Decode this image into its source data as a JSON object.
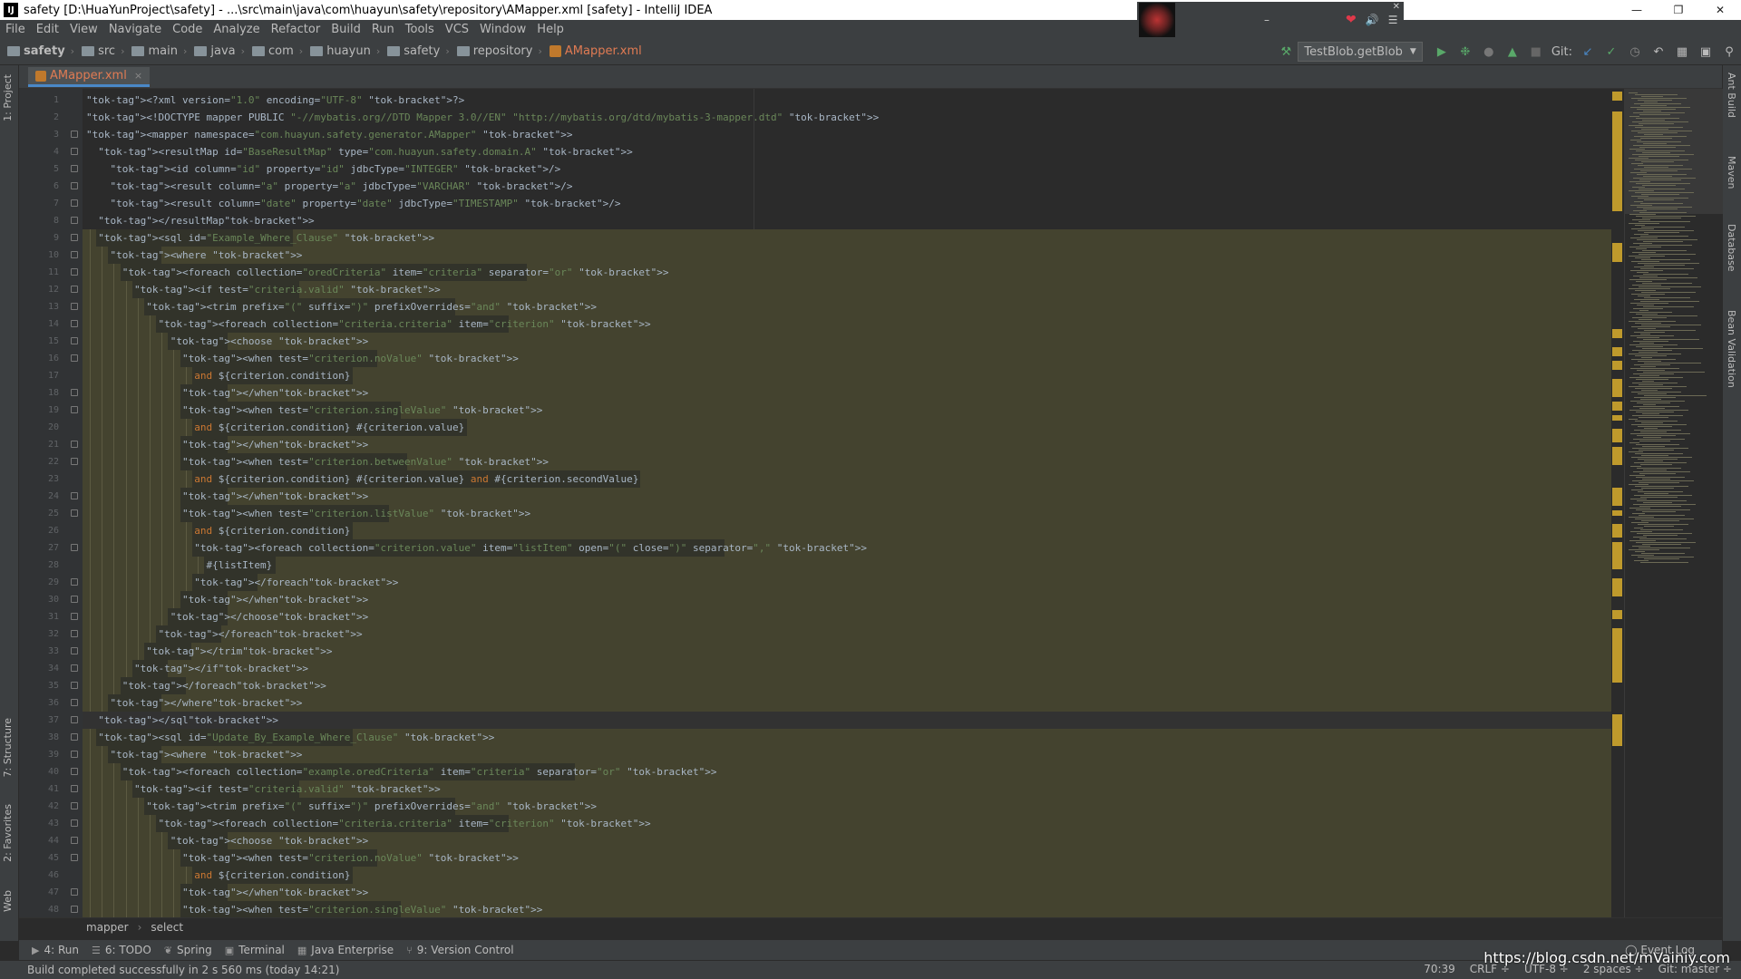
{
  "window": {
    "title": "safety [D:\\HuaYunProject\\safety] - ...\\src\\main\\java\\com\\huayun\\safety\\repository\\AMapper.xml [safety] - IntelliJ IDEA",
    "app_icon": "IJ"
  },
  "media_widget": {
    "min": "–",
    "close": "✕"
  },
  "menu": [
    "File",
    "Edit",
    "View",
    "Navigate",
    "Code",
    "Analyze",
    "Refactor",
    "Build",
    "Run",
    "Tools",
    "VCS",
    "Window",
    "Help"
  ],
  "breadcrumb": [
    "safety",
    "src",
    "main",
    "java",
    "com",
    "huayun",
    "safety",
    "repository",
    "AMapper.xml"
  ],
  "toolbar": {
    "run_config": "TestBlob.getBlob",
    "git_label": "Git:"
  },
  "left_tabs": [
    "1: Project",
    "7: Structure",
    "2: Favorites",
    "Web"
  ],
  "right_tabs": [
    "Ant Build",
    "Maven",
    "Database",
    "Bean Validation"
  ],
  "editor_tab": {
    "label": "AMapper.xml",
    "close": "×"
  },
  "code_lines": [
    {
      "n": "1",
      "t": "<?xml version=\"1.0\" encoding=\"UTF-8\" ?>"
    },
    {
      "n": "2",
      "t": "<!DOCTYPE mapper PUBLIC \"-//mybatis.org//DTD Mapper 3.0//EN\" \"http://mybatis.org/dtd/mybatis-3-mapper.dtd\" >"
    },
    {
      "n": "3",
      "t": "<mapper namespace=\"com.huayun.safety.generator.AMapper\" >"
    },
    {
      "n": "4",
      "t": "  <resultMap id=\"BaseResultMap\" type=\"com.huayun.safety.domain.A\" >"
    },
    {
      "n": "5",
      "t": "    <id column=\"id\" property=\"id\" jdbcType=\"INTEGER\" />"
    },
    {
      "n": "6",
      "t": "    <result column=\"a\" property=\"a\" jdbcType=\"VARCHAR\" />"
    },
    {
      "n": "7",
      "t": "    <result column=\"date\" property=\"date\" jdbcType=\"TIMESTAMP\" />"
    },
    {
      "n": "8",
      "t": "  </resultMap>"
    },
    {
      "n": "9",
      "t": "  <sql id=\"Example_Where_Clause\" >"
    },
    {
      "n": "10",
      "t": "    <where >"
    },
    {
      "n": "11",
      "t": "      <foreach collection=\"oredCriteria\" item=\"criteria\" separator=\"or\" >"
    },
    {
      "n": "12",
      "t": "        <if test=\"criteria.valid\" >"
    },
    {
      "n": "13",
      "t": "          <trim prefix=\"(\" suffix=\")\" prefixOverrides=\"and\" >"
    },
    {
      "n": "14",
      "t": "            <foreach collection=\"criteria.criteria\" item=\"criterion\" >"
    },
    {
      "n": "15",
      "t": "              <choose >"
    },
    {
      "n": "16",
      "t": "                <when test=\"criterion.noValue\" >"
    },
    {
      "n": "17",
      "t": "                  and ${criterion.condition}"
    },
    {
      "n": "18",
      "t": "                </when>"
    },
    {
      "n": "19",
      "t": "                <when test=\"criterion.singleValue\" >"
    },
    {
      "n": "20",
      "t": "                  and ${criterion.condition} #{criterion.value}"
    },
    {
      "n": "21",
      "t": "                </when>"
    },
    {
      "n": "22",
      "t": "                <when test=\"criterion.betweenValue\" >"
    },
    {
      "n": "23",
      "t": "                  and ${criterion.condition} #{criterion.value} and #{criterion.secondValue}"
    },
    {
      "n": "24",
      "t": "                </when>"
    },
    {
      "n": "25",
      "t": "                <when test=\"criterion.listValue\" >"
    },
    {
      "n": "26",
      "t": "                  and ${criterion.condition}"
    },
    {
      "n": "27",
      "t": "                  <foreach collection=\"criterion.value\" item=\"listItem\" open=\"(\" close=\")\" separator=\",\" >"
    },
    {
      "n": "28",
      "t": "                    #{listItem}"
    },
    {
      "n": "29",
      "t": "                  </foreach>"
    },
    {
      "n": "30",
      "t": "                </when>"
    },
    {
      "n": "31",
      "t": "              </choose>"
    },
    {
      "n": "32",
      "t": "            </foreach>"
    },
    {
      "n": "33",
      "t": "          </trim>"
    },
    {
      "n": "34",
      "t": "        </if>"
    },
    {
      "n": "35",
      "t": "      </foreach>"
    },
    {
      "n": "36",
      "t": "    </where>"
    },
    {
      "n": "37",
      "t": "  </sql>"
    },
    {
      "n": "38",
      "t": "  <sql id=\"Update_By_Example_Where_Clause\" >"
    },
    {
      "n": "39",
      "t": "    <where >"
    },
    {
      "n": "40",
      "t": "      <foreach collection=\"example.oredCriteria\" item=\"criteria\" separator=\"or\" >"
    },
    {
      "n": "41",
      "t": "        <if test=\"criteria.valid\" >"
    },
    {
      "n": "42",
      "t": "          <trim prefix=\"(\" suffix=\")\" prefixOverrides=\"and\" >"
    },
    {
      "n": "43",
      "t": "            <foreach collection=\"criteria.criteria\" item=\"criterion\" >"
    },
    {
      "n": "44",
      "t": "              <choose >"
    },
    {
      "n": "45",
      "t": "                <when test=\"criterion.noValue\" >"
    },
    {
      "n": "46",
      "t": "                  and ${criterion.condition}"
    },
    {
      "n": "47",
      "t": "                </when>"
    },
    {
      "n": "48",
      "t": "                <when test=\"criterion.singleValue\" >"
    }
  ],
  "editor_breadcrumb": [
    "mapper",
    "select"
  ],
  "tool_windows": [
    {
      "label": "4: Run",
      "icon": "play-icon"
    },
    {
      "label": "6: TODO",
      "icon": "list-icon"
    },
    {
      "label": "Spring",
      "icon": "leaf-icon"
    },
    {
      "label": "Terminal",
      "icon": "terminal-icon"
    },
    {
      "label": "Java Enterprise",
      "icon": "enterprise-icon"
    },
    {
      "label": "9: Version Control",
      "icon": "vcs-icon"
    }
  ],
  "event_log": "Event Log",
  "status": {
    "message": "Build completed successfully in 2 s 560 ms (today 14:21)",
    "position": "70:39",
    "line_sep": "CRLF ÷",
    "encoding": "UTF-8 ÷",
    "indent": "2 spaces ÷",
    "git": "Git: master ÷"
  },
  "watermark": "https://blog.csdn.net/mVainiy.com",
  "colors": {
    "tag": "#e8bf6a",
    "attr_value": "#6a8759",
    "keyword": "#cc7832",
    "highlight_block": "#4d4a36",
    "scroll_marker": "#bf9a2c",
    "active_file": "#e07b53"
  }
}
